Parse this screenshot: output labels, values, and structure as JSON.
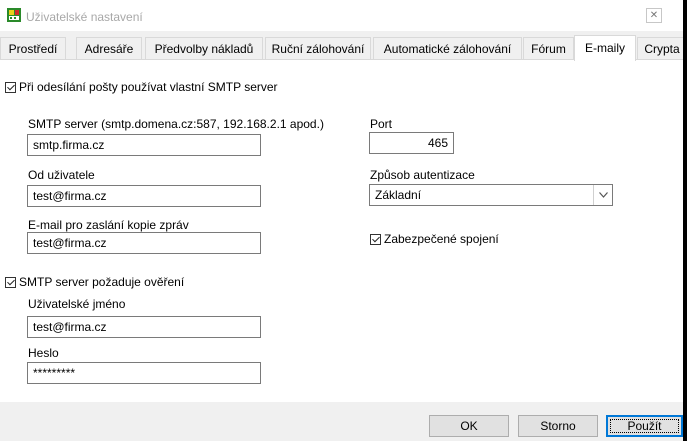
{
  "window": {
    "title": "Uživatelské nastavení",
    "close_label": "✕"
  },
  "tabs": [
    {
      "label": "Prostředí"
    },
    {
      "label": "Adresáře"
    },
    {
      "label": "Předvolby nákladů"
    },
    {
      "label": "Ruční zálohování"
    },
    {
      "label": "Automatické zálohování"
    },
    {
      "label": "Fórum"
    },
    {
      "label": "E-maily"
    },
    {
      "label": "Crypta"
    }
  ],
  "active_tab": "E-maily",
  "form": {
    "use_own_smtp": {
      "label": "Při odesílání pošty používat vlastní SMTP server",
      "checked": true
    },
    "smtp_server": {
      "label": "SMTP server (smtp.domena.cz:587, 192.168.2.1 apod.)",
      "value": "smtp.firma.cz"
    },
    "port": {
      "label": "Port",
      "value": "465"
    },
    "from_user": {
      "label": "Od uživatele",
      "value": "test@firma.cz"
    },
    "auth_method": {
      "label": "Způsob autentizace",
      "value": "Základní"
    },
    "copy_email": {
      "label": "E-mail pro zaslání kopie zpráv",
      "value": "test@firma.cz"
    },
    "secure_connection": {
      "label": "Zabezpečené spojení",
      "checked": true
    },
    "requires_auth": {
      "label": "SMTP server požaduje ověření",
      "checked": true
    },
    "username": {
      "label": "Uživatelské jméno",
      "value": "test@firma.cz"
    },
    "password": {
      "label": "Heslo",
      "value": "*********"
    }
  },
  "buttons": {
    "ok": "OK",
    "cancel": "Storno",
    "apply": "Použít"
  }
}
